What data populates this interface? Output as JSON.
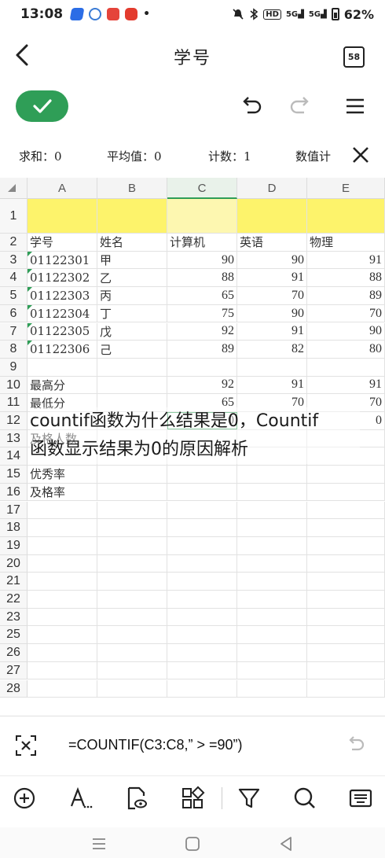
{
  "status": {
    "time": "13:08",
    "battery": "62%",
    "net1": "5G",
    "net2": "5G",
    "hd": "HD",
    "apps": [
      "#2b6de6",
      "#3a7bd5",
      "#e5443a",
      "#e33b2e"
    ],
    "dot": "•"
  },
  "title_bar": {
    "title": "学号",
    "sheet_count": "58"
  },
  "stats": {
    "sum": "求和：0",
    "avg": "平均值：0",
    "count": "计数：1",
    "numcount": "数值计"
  },
  "columns": [
    "A",
    "B",
    "C",
    "D",
    "E"
  ],
  "rows": [
    {
      "n": "1",
      "cells": [
        "",
        "",
        "",
        "",
        ""
      ],
      "highlight": true
    },
    {
      "n": "2",
      "cells": [
        "学号",
        "姓名",
        "计算机",
        "英语",
        "物理"
      ]
    },
    {
      "n": "3",
      "cells": [
        "01122301",
        "甲",
        "90",
        "90",
        "91"
      ],
      "flag": true
    },
    {
      "n": "4",
      "cells": [
        "01122302",
        "乙",
        "88",
        "91",
        "88"
      ],
      "flag": true
    },
    {
      "n": "5",
      "cells": [
        "01122303",
        "丙",
        "65",
        "70",
        "89"
      ],
      "flag": true
    },
    {
      "n": "6",
      "cells": [
        "01122304",
        "丁",
        "75",
        "90",
        "70"
      ],
      "flag": true
    },
    {
      "n": "7",
      "cells": [
        "01122305",
        "戊",
        "92",
        "91",
        "90"
      ],
      "flag": true
    },
    {
      "n": "8",
      "cells": [
        "01122306",
        "己",
        "89",
        "82",
        "80"
      ],
      "flag": true
    },
    {
      "n": "9",
      "cells": [
        "",
        "",
        "",
        "",
        ""
      ]
    },
    {
      "n": "10",
      "cells": [
        "最高分",
        "",
        "92",
        "91",
        "91"
      ]
    },
    {
      "n": "11",
      "cells": [
        "最低分",
        "",
        "65",
        "70",
        "70"
      ]
    },
    {
      "n": "12",
      "cells": [
        "",
        "",
        "0",
        "",
        "0"
      ]
    },
    {
      "n": "13",
      "cells": [
        "及格人数",
        "",
        "",
        "",
        ""
      ]
    },
    {
      "n": "14",
      "cells": [
        "",
        "",
        "",
        "",
        ""
      ]
    },
    {
      "n": "15",
      "cells": [
        "优秀率",
        "",
        "",
        "",
        ""
      ]
    },
    {
      "n": "16",
      "cells": [
        "及格率",
        "",
        "",
        "",
        ""
      ]
    },
    {
      "n": "17",
      "cells": [
        "",
        "",
        "",
        "",
        ""
      ]
    },
    {
      "n": "18",
      "cells": [
        "",
        "",
        "",
        "",
        ""
      ]
    },
    {
      "n": "19",
      "cells": [
        "",
        "",
        "",
        "",
        ""
      ]
    },
    {
      "n": "20",
      "cells": [
        "",
        "",
        "",
        "",
        ""
      ]
    },
    {
      "n": "21",
      "cells": [
        "",
        "",
        "",
        "",
        ""
      ]
    },
    {
      "n": "22",
      "cells": [
        "",
        "",
        "",
        "",
        ""
      ]
    },
    {
      "n": "23",
      "cells": [
        "",
        "",
        "",
        "",
        ""
      ]
    },
    {
      "n": "25",
      "cells": [
        "",
        "",
        "",
        "",
        ""
      ]
    },
    {
      "n": "26",
      "cells": [
        "",
        "",
        "",
        "",
        ""
      ]
    },
    {
      "n": "27",
      "cells": [
        "",
        "",
        "",
        "",
        ""
      ]
    },
    {
      "n": "28",
      "cells": [
        "",
        "",
        "",
        "",
        ""
      ]
    }
  ],
  "overlay": {
    "line1": "countif函数为什么结果是0，Countif",
    "line2": "函数显示结果为0的原因解析"
  },
  "formula": "=COUNTIF(C3:C8,” > =90”)",
  "colors": {
    "accent": "#2f9e57",
    "highlight_row": "#fdf36b",
    "highlight_selected": "#fdf7b0"
  }
}
